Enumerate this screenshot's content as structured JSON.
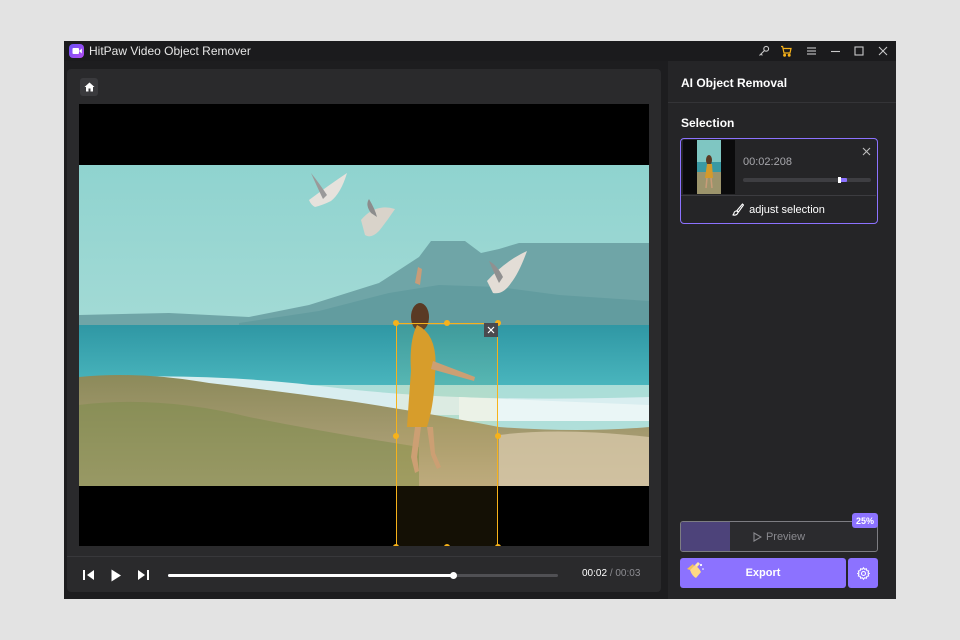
{
  "window": {
    "title": "HitPaw Video Object Remover",
    "icons": [
      "key-icon",
      "cart-icon",
      "menu-icon",
      "minimize-icon",
      "maximize-icon",
      "close-icon"
    ]
  },
  "editor": {
    "home_icon": "home-icon",
    "playback": {
      "current_time": "00:02",
      "separator": "/",
      "total_time": "00:03",
      "progress": 0.73,
      "icons": [
        "step-back-icon",
        "play-icon",
        "step-forward-icon"
      ]
    }
  },
  "panel": {
    "title": "AI Object Removal",
    "selection_label": "Selection",
    "selection": {
      "timestamp": "00:02:208",
      "range_start": 0.75,
      "range_end": 0.81,
      "adjust_label": "adjust selection"
    },
    "preview_label": "Preview",
    "progress_badge": "25%",
    "progress": 0.25,
    "export_label": "Export"
  },
  "colors": {
    "accent": "#8c72ff",
    "selection_box": "#f7b21a",
    "background": "#1d1d1f",
    "panel": "#252527"
  }
}
